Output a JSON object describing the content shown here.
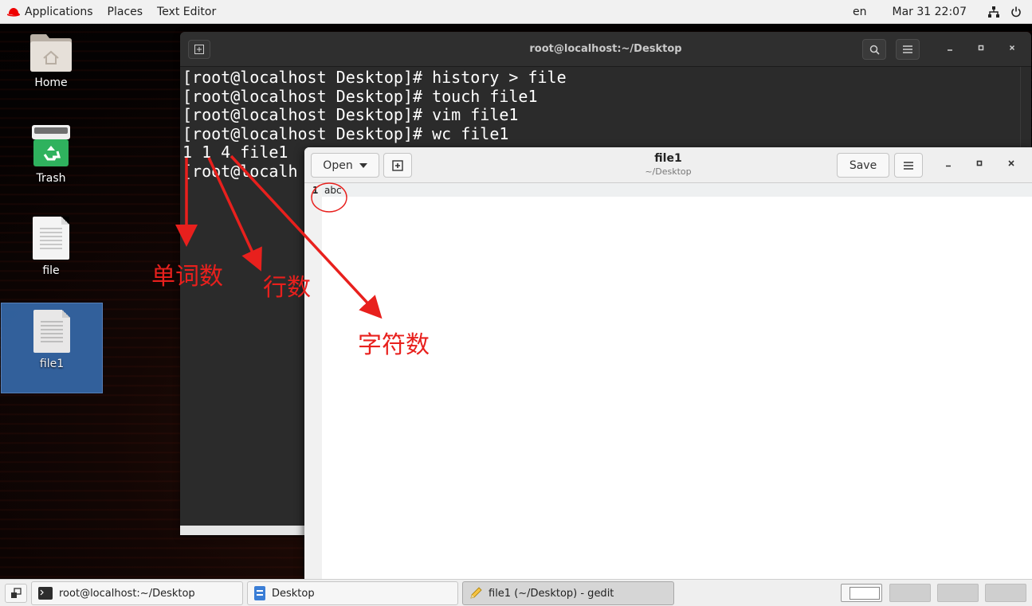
{
  "topbar": {
    "applications": "Applications",
    "places": "Places",
    "app_name": "Text Editor",
    "lang": "en",
    "clock": "Mar 31  22:07"
  },
  "desktop": {
    "icons": [
      {
        "label": "Home",
        "type": "folder"
      },
      {
        "label": "Trash",
        "type": "trash"
      },
      {
        "label": "file",
        "type": "document"
      },
      {
        "label": "file1",
        "type": "document",
        "selected": true
      }
    ]
  },
  "terminal": {
    "title": "root@localhost:~/Desktop",
    "lines": [
      "[root@localhost Desktop]# history > file",
      "[root@localhost Desktop]# touch file1",
      "[root@localhost Desktop]# vim file1",
      "[root@localhost Desktop]# wc file1",
      "1 1 4 file1",
      "[root@localh"
    ]
  },
  "gedit": {
    "open_label": "Open",
    "title": "file1",
    "subtitle": "~/Desktop",
    "save_label": "Save",
    "line_number": "1",
    "content": "abc"
  },
  "annotations": {
    "words": "单词数",
    "lines": "行数",
    "chars": "字符数",
    "color": "#e8201d"
  },
  "taskbar": {
    "tasks": [
      {
        "label": "root@localhost:~/Desktop",
        "icon": "terminal-icon"
      },
      {
        "label": "Desktop",
        "icon": "file-manager-icon"
      },
      {
        "label": "file1 (~/Desktop) - gedit",
        "icon": "text-editor-icon",
        "active": true
      }
    ]
  }
}
